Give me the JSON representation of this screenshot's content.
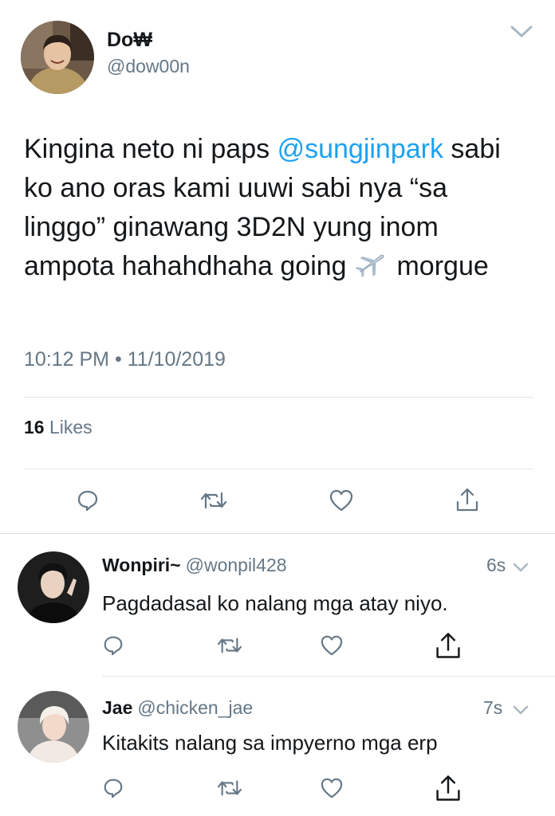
{
  "tweet": {
    "author_name": "Do₩",
    "author_handle": "@dow00n",
    "text_before": "Kingina neto ni paps ",
    "mention": "@sungjinpark",
    "text_after": " sabi ko ano oras kami uuwi sabi nya “sa linggo” ginawang 3D2N yung inom ampota hahahdhaha going ",
    "text_end": " morgue",
    "emoji_name": "airplane-icon",
    "timestamp": "10:12 PM • 11/10/2019",
    "likes_count": "16",
    "likes_label": " Likes"
  },
  "replies": [
    {
      "name": "Wonpiri~",
      "handle": "@wonpil428",
      "time": "6s",
      "text": "Pagdadasal ko nalang mga atay niyo."
    },
    {
      "name": "Jae",
      "handle": "@chicken_jae",
      "time": "7s",
      "text": "Kitakits nalang sa impyerno mga erp"
    }
  ],
  "icons": {
    "reply": "reply-icon",
    "retweet": "retweet-icon",
    "like": "heart-icon",
    "share": "share-icon",
    "more": "chevron-down-icon"
  },
  "colors": {
    "text": "#14171a",
    "secondary": "#657786",
    "link": "#1da1f2",
    "divider": "#e1e8ed"
  }
}
